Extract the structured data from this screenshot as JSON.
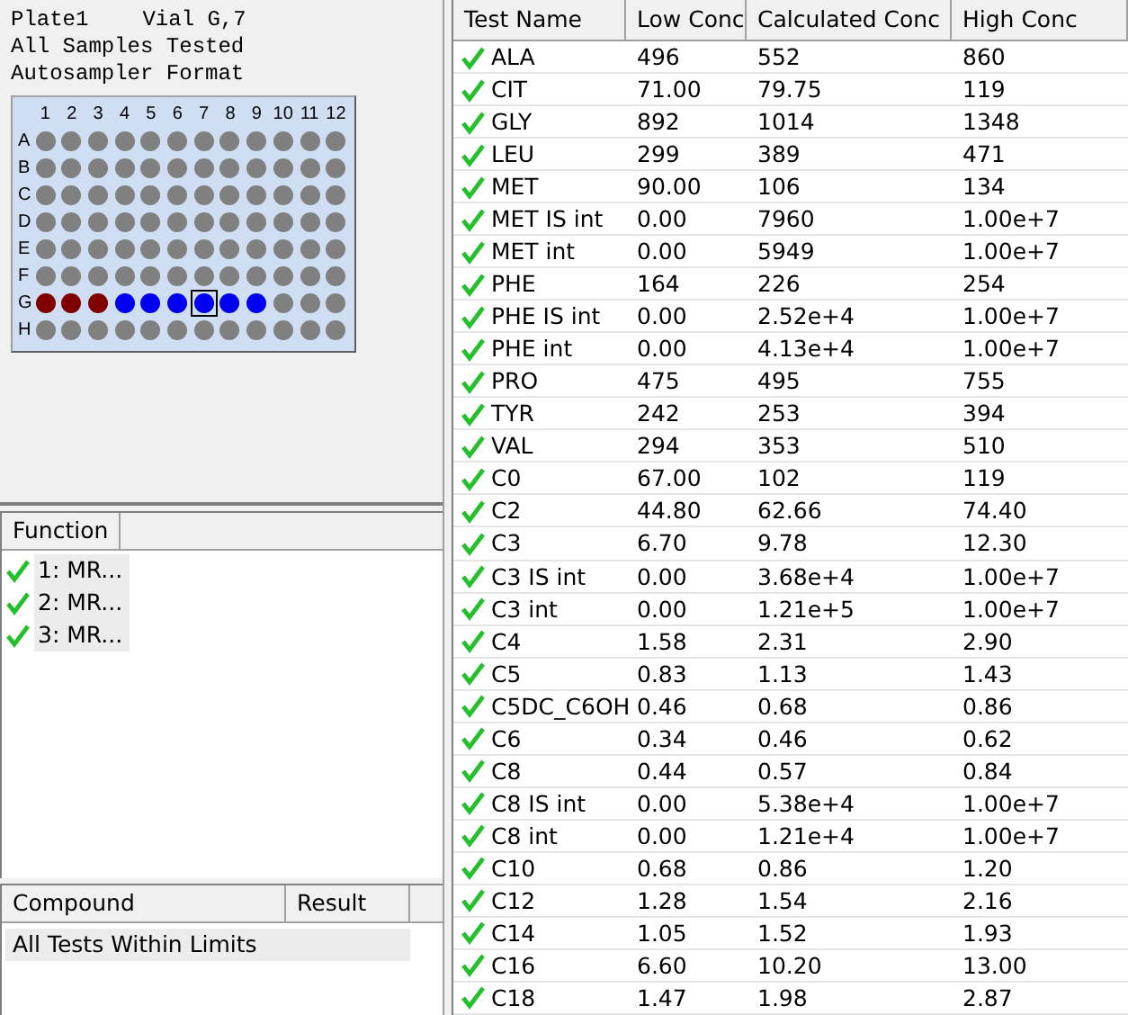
{
  "plate_info": {
    "plate": "Plate1",
    "vial": "Vial G,7",
    "status": "All Samples Tested",
    "format": "Autosampler Format"
  },
  "plate": {
    "columns": [
      "1",
      "2",
      "3",
      "4",
      "5",
      "6",
      "7",
      "8",
      "9",
      "10",
      "11",
      "12"
    ],
    "rows": [
      {
        "label": "A",
        "wells": [
          {
            "kind": "empty",
            "selected": false
          },
          {
            "kind": "empty",
            "selected": false
          },
          {
            "kind": "empty",
            "selected": false
          },
          {
            "kind": "empty",
            "selected": false
          },
          {
            "kind": "empty",
            "selected": false
          },
          {
            "kind": "empty",
            "selected": false
          },
          {
            "kind": "empty",
            "selected": false
          },
          {
            "kind": "empty",
            "selected": false
          },
          {
            "kind": "empty",
            "selected": false
          },
          {
            "kind": "empty",
            "selected": false
          },
          {
            "kind": "empty",
            "selected": false
          },
          {
            "kind": "empty",
            "selected": false
          }
        ]
      },
      {
        "label": "B",
        "wells": [
          {
            "kind": "empty",
            "selected": false
          },
          {
            "kind": "empty",
            "selected": false
          },
          {
            "kind": "empty",
            "selected": false
          },
          {
            "kind": "empty",
            "selected": false
          },
          {
            "kind": "empty",
            "selected": false
          },
          {
            "kind": "empty",
            "selected": false
          },
          {
            "kind": "empty",
            "selected": false
          },
          {
            "kind": "empty",
            "selected": false
          },
          {
            "kind": "empty",
            "selected": false
          },
          {
            "kind": "empty",
            "selected": false
          },
          {
            "kind": "empty",
            "selected": false
          },
          {
            "kind": "empty",
            "selected": false
          }
        ]
      },
      {
        "label": "C",
        "wells": [
          {
            "kind": "empty",
            "selected": false
          },
          {
            "kind": "empty",
            "selected": false
          },
          {
            "kind": "empty",
            "selected": false
          },
          {
            "kind": "empty",
            "selected": false
          },
          {
            "kind": "empty",
            "selected": false
          },
          {
            "kind": "empty",
            "selected": false
          },
          {
            "kind": "empty",
            "selected": false
          },
          {
            "kind": "empty",
            "selected": false
          },
          {
            "kind": "empty",
            "selected": false
          },
          {
            "kind": "empty",
            "selected": false
          },
          {
            "kind": "empty",
            "selected": false
          },
          {
            "kind": "empty",
            "selected": false
          }
        ]
      },
      {
        "label": "D",
        "wells": [
          {
            "kind": "empty",
            "selected": false
          },
          {
            "kind": "empty",
            "selected": false
          },
          {
            "kind": "empty",
            "selected": false
          },
          {
            "kind": "empty",
            "selected": false
          },
          {
            "kind": "empty",
            "selected": false
          },
          {
            "kind": "empty",
            "selected": false
          },
          {
            "kind": "empty",
            "selected": false
          },
          {
            "kind": "empty",
            "selected": false
          },
          {
            "kind": "empty",
            "selected": false
          },
          {
            "kind": "empty",
            "selected": false
          },
          {
            "kind": "empty",
            "selected": false
          },
          {
            "kind": "empty",
            "selected": false
          }
        ]
      },
      {
        "label": "E",
        "wells": [
          {
            "kind": "empty",
            "selected": false
          },
          {
            "kind": "empty",
            "selected": false
          },
          {
            "kind": "empty",
            "selected": false
          },
          {
            "kind": "empty",
            "selected": false
          },
          {
            "kind": "empty",
            "selected": false
          },
          {
            "kind": "empty",
            "selected": false
          },
          {
            "kind": "empty",
            "selected": false
          },
          {
            "kind": "empty",
            "selected": false
          },
          {
            "kind": "empty",
            "selected": false
          },
          {
            "kind": "empty",
            "selected": false
          },
          {
            "kind": "empty",
            "selected": false
          },
          {
            "kind": "empty",
            "selected": false
          }
        ]
      },
      {
        "label": "F",
        "wells": [
          {
            "kind": "empty",
            "selected": false
          },
          {
            "kind": "empty",
            "selected": false
          },
          {
            "kind": "empty",
            "selected": false
          },
          {
            "kind": "empty",
            "selected": false
          },
          {
            "kind": "empty",
            "selected": false
          },
          {
            "kind": "empty",
            "selected": false
          },
          {
            "kind": "empty",
            "selected": false
          },
          {
            "kind": "empty",
            "selected": false
          },
          {
            "kind": "empty",
            "selected": false
          },
          {
            "kind": "empty",
            "selected": false
          },
          {
            "kind": "empty",
            "selected": false
          },
          {
            "kind": "empty",
            "selected": false
          }
        ]
      },
      {
        "label": "G",
        "wells": [
          {
            "kind": "done",
            "selected": false
          },
          {
            "kind": "done",
            "selected": false
          },
          {
            "kind": "done",
            "selected": false
          },
          {
            "kind": "queued",
            "selected": false
          },
          {
            "kind": "queued",
            "selected": false
          },
          {
            "kind": "queued",
            "selected": false
          },
          {
            "kind": "queued",
            "selected": true
          },
          {
            "kind": "queued",
            "selected": false
          },
          {
            "kind": "queued",
            "selected": false
          },
          {
            "kind": "empty",
            "selected": false
          },
          {
            "kind": "empty",
            "selected": false
          },
          {
            "kind": "empty",
            "selected": false
          }
        ]
      },
      {
        "label": "H",
        "wells": [
          {
            "kind": "empty",
            "selected": false
          },
          {
            "kind": "empty",
            "selected": false
          },
          {
            "kind": "empty",
            "selected": false
          },
          {
            "kind": "empty",
            "selected": false
          },
          {
            "kind": "empty",
            "selected": false
          },
          {
            "kind": "empty",
            "selected": false
          },
          {
            "kind": "empty",
            "selected": false
          },
          {
            "kind": "empty",
            "selected": false
          },
          {
            "kind": "empty",
            "selected": false
          },
          {
            "kind": "empty",
            "selected": false
          },
          {
            "kind": "empty",
            "selected": false
          },
          {
            "kind": "empty",
            "selected": false
          }
        ]
      }
    ]
  },
  "functions": {
    "columns": [
      "Function"
    ],
    "items": [
      {
        "label": "1: MR...",
        "passed": true
      },
      {
        "label": "2: MR...",
        "passed": true
      },
      {
        "label": "3: MR...",
        "passed": true
      }
    ]
  },
  "compounds": {
    "columns": [
      "Compound",
      "Result"
    ],
    "rows": [
      "All Tests Within Limits"
    ]
  },
  "tests": {
    "columns": [
      "Test Name",
      "Low Conc",
      "Calculated Conc",
      "High Conc"
    ],
    "rows": [
      {
        "name": "ALA",
        "low": "496",
        "calc": "552",
        "high": "860",
        "passed": true
      },
      {
        "name": "CIT",
        "low": "71.00",
        "calc": "79.75",
        "high": "119",
        "passed": true
      },
      {
        "name": "GLY",
        "low": "892",
        "calc": "1014",
        "high": "1348",
        "passed": true
      },
      {
        "name": "LEU",
        "low": "299",
        "calc": "389",
        "high": "471",
        "passed": true
      },
      {
        "name": "MET",
        "low": "90.00",
        "calc": "106",
        "high": "134",
        "passed": true
      },
      {
        "name": "MET IS int",
        "low": "0.00",
        "calc": "7960",
        "high": "1.00e+7",
        "passed": true
      },
      {
        "name": "MET int",
        "low": "0.00",
        "calc": "5949",
        "high": "1.00e+7",
        "passed": true
      },
      {
        "name": "PHE",
        "low": "164",
        "calc": "226",
        "high": "254",
        "passed": true
      },
      {
        "name": "PHE IS int",
        "low": "0.00",
        "calc": "2.52e+4",
        "high": "1.00e+7",
        "passed": true
      },
      {
        "name": "PHE int",
        "low": "0.00",
        "calc": "4.13e+4",
        "high": "1.00e+7",
        "passed": true
      },
      {
        "name": "PRO",
        "low": "475",
        "calc": "495",
        "high": "755",
        "passed": true
      },
      {
        "name": "TYR",
        "low": "242",
        "calc": "253",
        "high": "394",
        "passed": true
      },
      {
        "name": "VAL",
        "low": "294",
        "calc": "353",
        "high": "510",
        "passed": true
      },
      {
        "name": "C0",
        "low": "67.00",
        "calc": "102",
        "high": "119",
        "passed": true
      },
      {
        "name": "C2",
        "low": "44.80",
        "calc": "62.66",
        "high": "74.40",
        "passed": true
      },
      {
        "name": "C3",
        "low": "6.70",
        "calc": "9.78",
        "high": "12.30",
        "passed": true
      },
      {
        "name": "C3 IS int",
        "low": "0.00",
        "calc": "3.68e+4",
        "high": "1.00e+7",
        "passed": true
      },
      {
        "name": "C3 int",
        "low": "0.00",
        "calc": "1.21e+5",
        "high": "1.00e+7",
        "passed": true
      },
      {
        "name": "C4",
        "low": "1.58",
        "calc": "2.31",
        "high": "2.90",
        "passed": true
      },
      {
        "name": "C5",
        "low": "0.83",
        "calc": "1.13",
        "high": "1.43",
        "passed": true
      },
      {
        "name": "C5DC_C6OH",
        "low": "0.46",
        "calc": "0.68",
        "high": "0.86",
        "passed": true
      },
      {
        "name": "C6",
        "low": "0.34",
        "calc": "0.46",
        "high": "0.62",
        "passed": true
      },
      {
        "name": "C8",
        "low": "0.44",
        "calc": "0.57",
        "high": "0.84",
        "passed": true
      },
      {
        "name": "C8 IS int",
        "low": "0.00",
        "calc": "5.38e+4",
        "high": "1.00e+7",
        "passed": true
      },
      {
        "name": "C8 int",
        "low": "0.00",
        "calc": "1.21e+4",
        "high": "1.00e+7",
        "passed": true
      },
      {
        "name": "C10",
        "low": "0.68",
        "calc": "0.86",
        "high": "1.20",
        "passed": true
      },
      {
        "name": "C12",
        "low": "1.28",
        "calc": "1.54",
        "high": "2.16",
        "passed": true
      },
      {
        "name": "C14",
        "low": "1.05",
        "calc": "1.52",
        "high": "1.93",
        "passed": true
      },
      {
        "name": "C16",
        "low": "6.60",
        "calc": "10.20",
        "high": "13.00",
        "passed": true
      },
      {
        "name": "C18",
        "low": "1.47",
        "calc": "1.98",
        "high": "2.87",
        "passed": true
      }
    ]
  }
}
